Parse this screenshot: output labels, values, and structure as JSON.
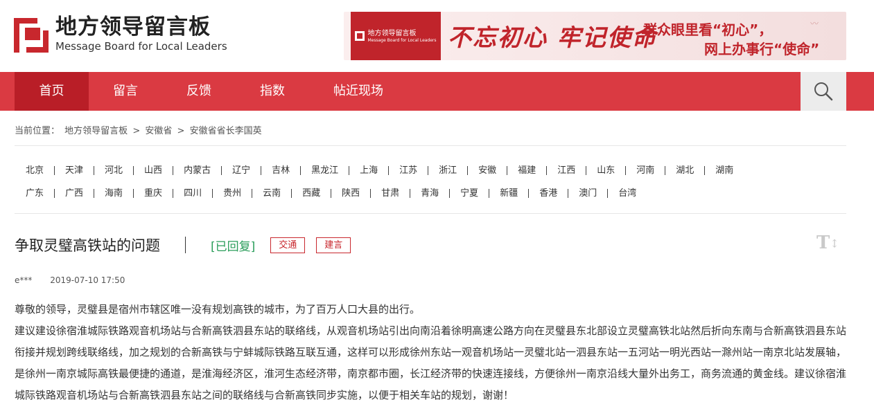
{
  "header": {
    "logo_cn": "地方领导留言板",
    "logo_en": "Message Board for Local Leaders",
    "banner": {
      "mini_logo_cn": "地方领导留言板",
      "mini_logo_en": "Message Board for Local Leaders",
      "slogan": "不忘初心 牢记使命",
      "right_line1": "群众眼里看“初心”，",
      "right_line2": "网上办事行“使命”"
    }
  },
  "nav": {
    "items": [
      {
        "label": "首页",
        "active": true
      },
      {
        "label": "留言"
      },
      {
        "label": "反馈"
      },
      {
        "label": "指数"
      },
      {
        "label": "帖近现场"
      }
    ],
    "search_icon": "search-icon"
  },
  "breadcrumb": {
    "prefix": "当前位置：",
    "items": [
      "地方领导留言板",
      "安徽省",
      "安徽省省长李国英"
    ],
    "separator": ">"
  },
  "provinces": {
    "row1": [
      "北京",
      "天津",
      "河北",
      "山西",
      "内蒙古",
      "辽宁",
      "吉林",
      "黑龙江",
      "上海",
      "江苏",
      "浙江",
      "安徽",
      "福建",
      "江西",
      "山东",
      "河南",
      "湖北",
      "湖南"
    ],
    "row2": [
      "广东",
      "广西",
      "海南",
      "重庆",
      "四川",
      "贵州",
      "云南",
      "西藏",
      "陕西",
      "甘肃",
      "青海",
      "宁夏",
      "新疆",
      "香港",
      "澳门",
      "台湾"
    ]
  },
  "message": {
    "title": "争取灵璧高铁站的问题",
    "status": "[已回复]",
    "tags": [
      "交通",
      "建言"
    ],
    "font_toggle": "T",
    "author": "e***",
    "datetime": "2019-07-10 17:50",
    "paragraphs": [
      "尊敬的领导，灵璧县是宿州市辖区唯一没有规划高铁的城市，为了百万人口大县的出行。",
      "建议建设徐宿淮城际铁路观音机场站与合新高铁泗县东站的联络线，从观音机场站引出向南沿着徐明高速公路方向在灵璧县东北部设立灵璧高铁北站然后折向东南与合新高铁泗县东站衔接并规划跨线联络线，加之规划的合新高铁与宁蚌城际铁路互联互通，这样可以形成徐州东站一观音机场站一灵璧北站一泗县东站一五河站一明光西站一滁州站一南京北站发展轴，是徐州一南京城际高铁最便捷的通道，是淮海经济区，淮河生态经济带，南京都市圈，长江经济带的快速连接线，方便徐州一南京沿线大量外出务工，商务流通的黄金线。建议徐宿淮城际铁路观音机场站与合新高铁泗县东站之间的联络线与合新高铁同步实施，以便于相关车站的规划，谢谢！"
    ]
  },
  "colors": {
    "brand_red": "#da3a42",
    "active_red": "#b91e27",
    "replied_green": "#2a9d5a"
  }
}
